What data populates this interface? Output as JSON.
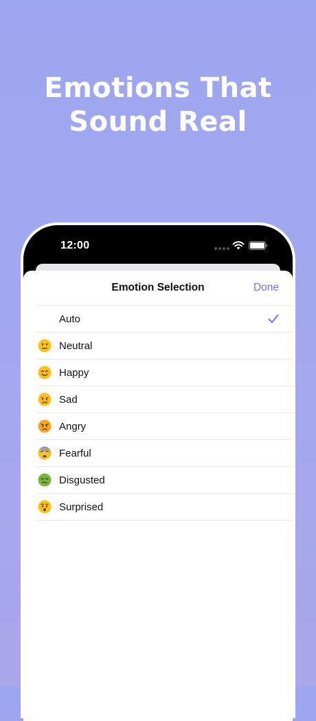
{
  "headline": {
    "line1": "Emotions That",
    "line2": "Sound Real"
  },
  "status_bar": {
    "time": "12:00",
    "icons": [
      "signal-dots-icon",
      "wifi-icon",
      "battery-icon"
    ]
  },
  "sheet": {
    "title": "Emotion Selection",
    "done_label": "Done"
  },
  "emotions": [
    {
      "label": "Auto",
      "emoji": "none",
      "selected": true
    },
    {
      "label": "Neutral",
      "emoji": "neutral-face-icon",
      "selected": false
    },
    {
      "label": "Happy",
      "emoji": "smiling-face-icon",
      "selected": false
    },
    {
      "label": "Sad",
      "emoji": "crying-face-icon",
      "selected": false
    },
    {
      "label": "Angry",
      "emoji": "angry-face-icon",
      "selected": false
    },
    {
      "label": "Fearful",
      "emoji": "fearful-face-icon",
      "selected": false
    },
    {
      "label": "Disgusted",
      "emoji": "nauseated-face-icon",
      "selected": false
    },
    {
      "label": "Surprised",
      "emoji": "surprised-face-icon",
      "selected": false
    }
  ],
  "colors": {
    "accent": "#7c6df0",
    "background_top": "#9da6f0",
    "background_bottom": "#aaa6ea"
  }
}
